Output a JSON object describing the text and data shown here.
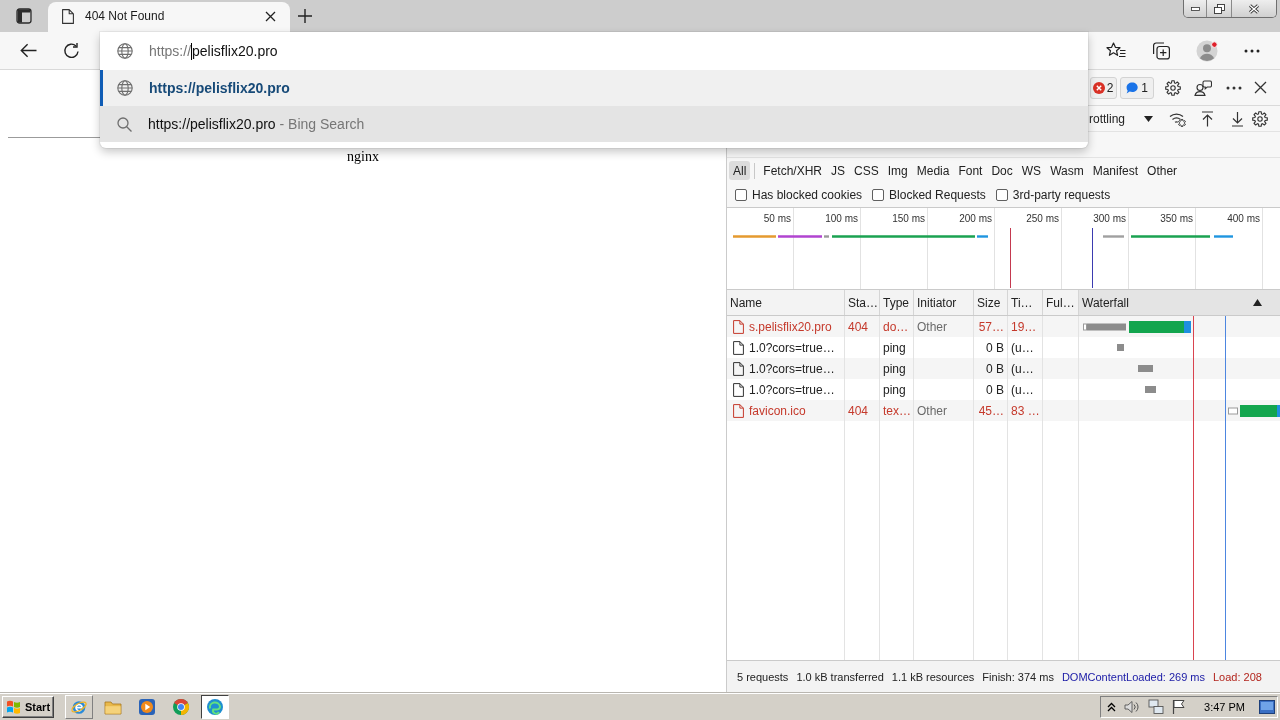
{
  "browser": {
    "tabs": [
      {
        "title": "404 Not Found",
        "selected": true
      }
    ],
    "omnibox": {
      "scheme": "https://",
      "host": "pelisflix20.pro",
      "suggestions": [
        {
          "kind": "url",
          "text": "https://pelisflix20.pro",
          "selected": true,
          "hovered": false
        },
        {
          "kind": "search",
          "text": "https://pelisflix20.pro",
          "suffix": "- Bing Search",
          "selected": false,
          "hovered": true
        }
      ]
    }
  },
  "page": {
    "footer": "nginx"
  },
  "devtools": {
    "issue_counters": [
      {
        "kind": "error",
        "count": "2"
      },
      {
        "kind": "info",
        "count": "1"
      }
    ],
    "throttling": "rottling",
    "type_filters": [
      {
        "label": "All",
        "selected": true
      },
      {
        "label": "Fetch/XHR",
        "selected": false
      },
      {
        "label": "JS",
        "selected": false
      },
      {
        "label": "CSS",
        "selected": false
      },
      {
        "label": "Img",
        "selected": false
      },
      {
        "label": "Media",
        "selected": false
      },
      {
        "label": "Font",
        "selected": false
      },
      {
        "label": "Doc",
        "selected": false
      },
      {
        "label": "WS",
        "selected": false
      },
      {
        "label": "Wasm",
        "selected": false
      },
      {
        "label": "Manifest",
        "selected": false
      },
      {
        "label": "Other",
        "selected": false
      }
    ],
    "options": [
      {
        "label": "Has blocked cookies",
        "checked": false
      },
      {
        "label": "Blocked Requests",
        "checked": false
      },
      {
        "label": "3rd-party requests",
        "checked": false
      }
    ],
    "overview": {
      "ticks": [
        "50 ms",
        "100 ms",
        "150 ms",
        "200 ms",
        "250 ms",
        "300 ms",
        "350 ms",
        "400 ms"
      ]
    },
    "table": {
      "columns": [
        {
          "label": "Name",
          "sorted": false
        },
        {
          "label": "Sta…",
          "sorted": false
        },
        {
          "label": "Type",
          "sorted": false
        },
        {
          "label": "Initiator",
          "sorted": false
        },
        {
          "label": "Size",
          "sorted": false
        },
        {
          "label": "Ti…",
          "sorted": false
        },
        {
          "label": "Ful…",
          "sorted": false
        },
        {
          "label": "Waterfall",
          "sorted": true
        }
      ],
      "rows": [
        {
          "name": "s.pelisflix20.pro",
          "status": "404",
          "type": "do…",
          "initiator": "Other",
          "size": "57…",
          "time": "19…",
          "failed": true
        },
        {
          "name": "1.0?cors=true…",
          "type": "ping",
          "size": "0 B",
          "time": "(u…",
          "failed": false
        },
        {
          "name": "1.0?cors=true…",
          "type": "ping",
          "size": "0 B",
          "time": "(u…",
          "failed": false
        },
        {
          "name": "1.0?cors=true…",
          "type": "ping",
          "size": "0 B",
          "time": "(u…",
          "failed": false
        },
        {
          "name": "favicon.ico",
          "status": "404",
          "type": "tex…",
          "initiator": "Other",
          "size": "45…",
          "time": "83 …",
          "failed": true
        }
      ]
    },
    "summary": [
      {
        "kind": "plain",
        "text": "5 requests"
      },
      {
        "kind": "plain",
        "text": "1.0 kB transferred"
      },
      {
        "kind": "plain",
        "text": "1.1 kB resources"
      },
      {
        "kind": "plain",
        "text": "Finish: 374 ms"
      },
      {
        "kind": "dom",
        "text": "DOMContentLoaded: 269 ms"
      },
      {
        "kind": "load",
        "text": "Load: 208"
      }
    ]
  },
  "taskbar": {
    "start": "Start",
    "apps": [
      {
        "kind": "ie",
        "selected": false,
        "hovered": true
      },
      {
        "kind": "explorer",
        "selected": false,
        "hovered": false
      },
      {
        "kind": "media",
        "selected": false,
        "hovered": false
      },
      {
        "kind": "chrome",
        "selected": false,
        "hovered": false
      },
      {
        "kind": "edge",
        "selected": true,
        "hovered": false
      }
    ],
    "clock": "3:47 PM"
  }
}
